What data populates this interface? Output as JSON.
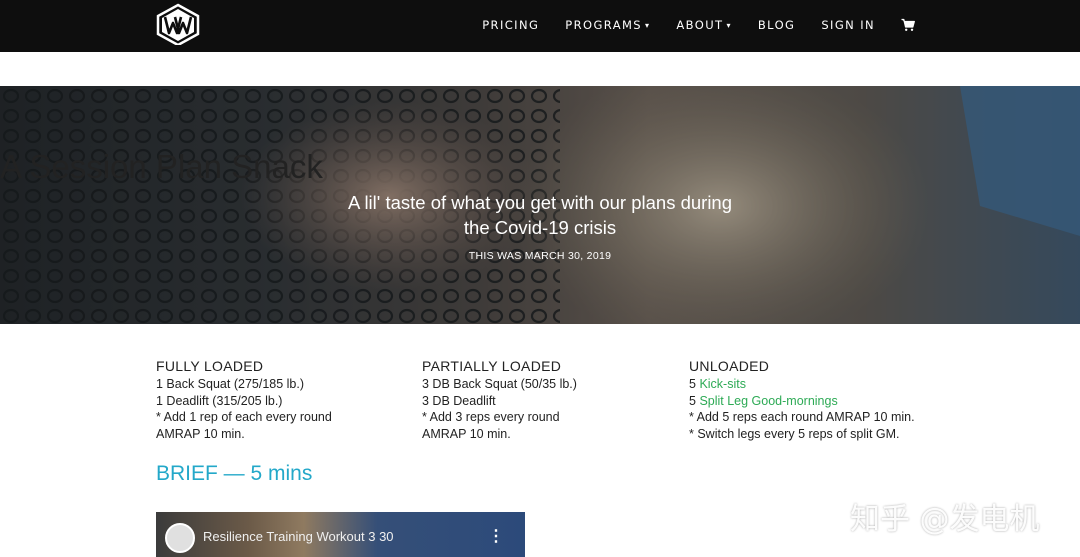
{
  "nav": {
    "logo_text": "WW",
    "items": [
      {
        "label": "PRICING"
      },
      {
        "label": "PROGRAMS",
        "caret": "⌄"
      },
      {
        "label": "ABOUT",
        "caret": "⌄"
      },
      {
        "label": "BLOG"
      },
      {
        "label": "SIGN IN"
      }
    ],
    "cart_icon": "shopping-cart-icon"
  },
  "hero": {
    "title": "A Session Plan Snack",
    "subtitle": "A lil' taste of what you get with our plans during the Covid-19 crisis",
    "date": "THIS WAS MARCH 30, 2019"
  },
  "columns": [
    {
      "title": "FULLY LOADED",
      "lines": [
        "1 Back Squat (275/185 lb.)",
        "1 Deadlift (315/205 lb.)",
        "* Add 1 rep of each every round",
        "AMRAP 10 min."
      ]
    },
    {
      "title": "PARTIALLY LOADED",
      "lines": [
        "3 DB Back Squat (50/35 lb.)",
        "3 DB Deadlift",
        "* Add 3 reps every round",
        "AMRAP 10 min."
      ]
    },
    {
      "title": "UNLOADED",
      "line1_prefix": "5 ",
      "line1_link": "Kick-sits",
      "line2_prefix": "5 ",
      "line2_link": "Split Leg Good-mornings",
      "lines": [
        "* Add 5 reps each round AMRAP 10 min.",
        "* Switch legs every 5 reps of split GM."
      ]
    }
  ],
  "brief": "BRIEF — 5 mins",
  "video": {
    "title": "Resilience Training Workout 3 30",
    "menu": "⋮"
  },
  "watermark": "知乎 @发电机",
  "colors": {
    "nav_bg": "#0e0e0e",
    "link_green": "#2daa55",
    "brief_blue": "#23a8c9"
  }
}
